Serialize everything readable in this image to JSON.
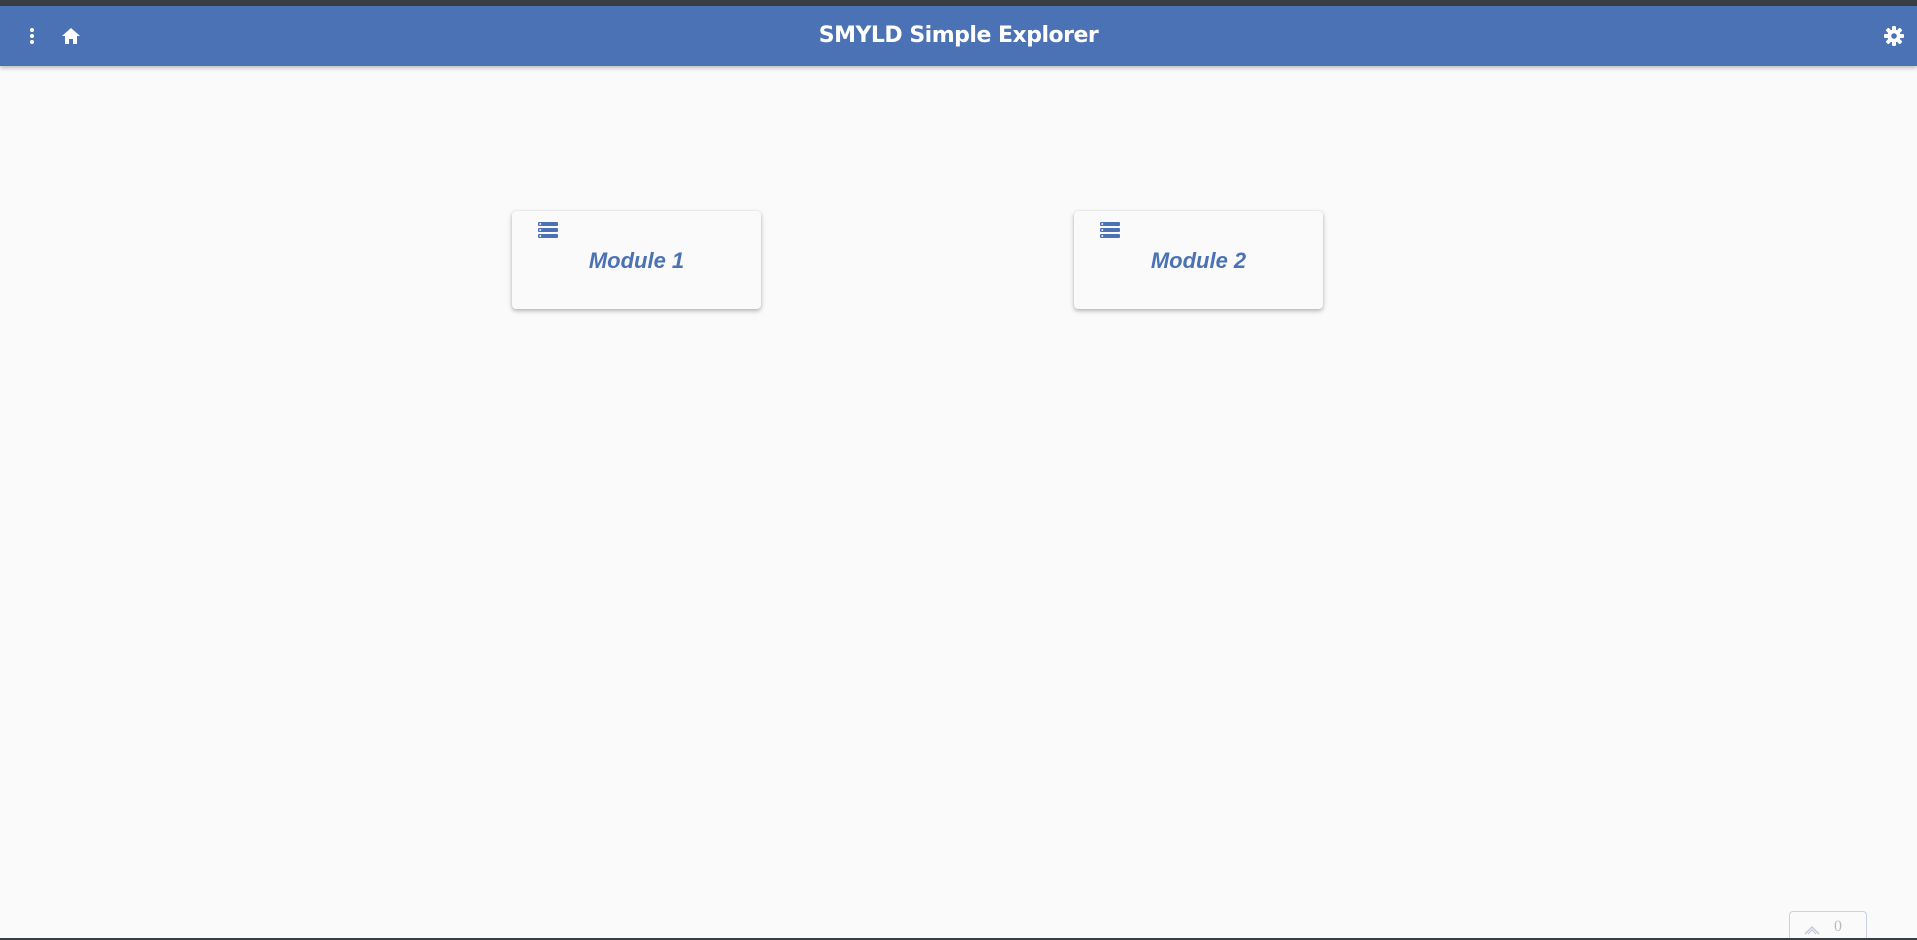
{
  "header": {
    "title": "SMYLD Simple Explorer",
    "menu_icon": "more-vert-icon",
    "home_icon": "home-icon",
    "settings_icon": "gear-icon",
    "background_color": "#4a72b4"
  },
  "modules": [
    {
      "label": "Module 1",
      "icon": "list-icon"
    },
    {
      "label": "Module 2",
      "icon": "list-icon"
    }
  ],
  "scroll_widget": {
    "icon": "chevron-up-icon",
    "count": "0"
  },
  "colors": {
    "accent": "#4a72b4",
    "page_background": "#fafafa"
  }
}
